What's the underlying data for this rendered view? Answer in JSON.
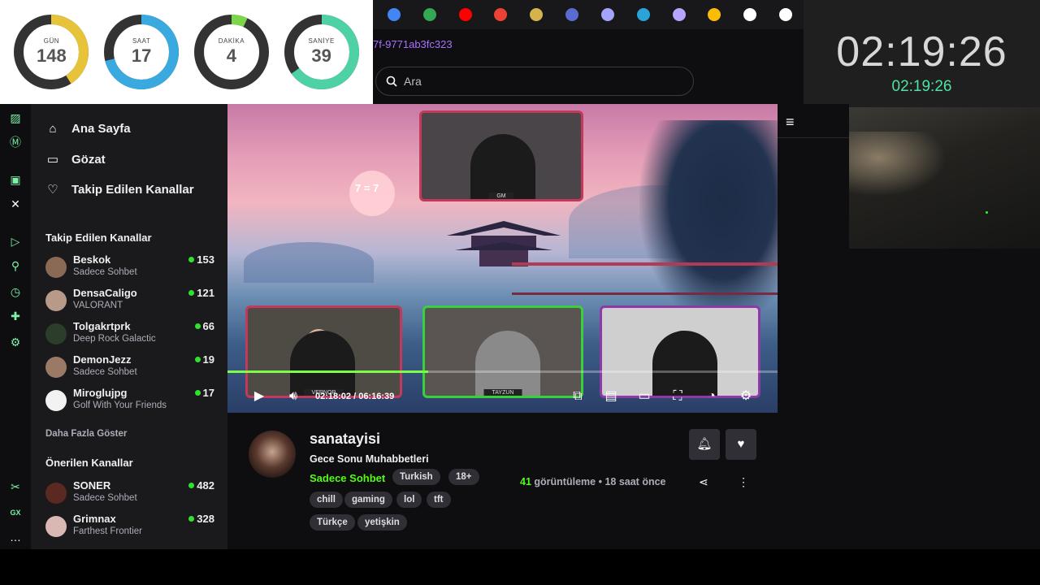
{
  "countdown": {
    "units": [
      {
        "label": "GÜN",
        "value": "148",
        "fraction": 0.41,
        "color": "#e7c33a"
      },
      {
        "label": "SAAT",
        "value": "17",
        "fraction": 0.71,
        "color": "#3aa9e0"
      },
      {
        "label": "DAKİKA",
        "value": "4",
        "fraction": 0.07,
        "color": "#7cd64a"
      },
      {
        "label": "SANİYE",
        "value": "39",
        "fraction": 0.65,
        "color": "#4fd1a6"
      }
    ]
  },
  "browser": {
    "bookmarks": [
      {
        "icon": "google-icon",
        "color": "#4285f4"
      },
      {
        "icon": "google-icon",
        "color": "#34a853"
      },
      {
        "icon": "youtube-icon",
        "color": "#ff0000"
      },
      {
        "icon": "google-icon",
        "color": "#ea4335"
      },
      {
        "icon": "download-icon",
        "color": "#d4b24c"
      },
      {
        "icon": "wordpress-icon",
        "color": "#5b6ad0"
      },
      {
        "icon": "document-icon",
        "color": "#a4a4ff"
      },
      {
        "icon": "globe-icon",
        "color": "#2aa3d8"
      },
      {
        "icon": "document-icon",
        "color": "#b6a4ff"
      },
      {
        "icon": "google-icon",
        "color": "#fbbc05"
      },
      {
        "icon": "wikipedia-icon",
        "color": "#ffffff"
      },
      {
        "icon": "wikipedia-icon",
        "color": "#ffffff"
      }
    ],
    "url_fragment": "7f-9771ab3fc323"
  },
  "search": {
    "placeholder": "Ara"
  },
  "clock": {
    "big": "02:19:26",
    "small": "02:19:26"
  },
  "nav": {
    "home": "Ana Sayfa",
    "browse": "Gözat",
    "following": "Takip Edilen Kanallar"
  },
  "followed": {
    "title": "Takip Edilen Kanallar",
    "channels": [
      {
        "name": "Beskok",
        "game": "Sadece Sohbet",
        "viewers": "153"
      },
      {
        "name": "DensaCaligo",
        "game": "VALORANT",
        "viewers": "121"
      },
      {
        "name": "Tolgakrtprk",
        "game": "Deep Rock Galactic",
        "viewers": "66"
      },
      {
        "name": "DemonJezz",
        "game": "Sadece Sohbet",
        "viewers": "19"
      },
      {
        "name": "Miroglujpg",
        "game": "Golf With Your Friends",
        "viewers": "17"
      }
    ],
    "show_more": "Daha Fazla Göster"
  },
  "recommended": {
    "title": "Önerilen Kanallar",
    "channels": [
      {
        "name": "SONER",
        "game": "Sadece Sohbet",
        "viewers": "482"
      },
      {
        "name": "Grimnax",
        "game": "Farthest Frontier",
        "viewers": "328"
      }
    ]
  },
  "video": {
    "overlay_badge": "7 = 7",
    "cam_tags": [
      "GM",
      "VERNOR",
      "TAYZUN"
    ],
    "time": "02:18:02 / 06:16:39",
    "progress": 0.365
  },
  "stream": {
    "channel": "sanatayisi",
    "title": "Gece Sonu Muhabbetleri",
    "category": "Sadece Sohbet",
    "tags": [
      "Turkish",
      "18+",
      "chill",
      "gaming",
      "lol",
      "tft",
      "Türkçe",
      "yetişkin"
    ],
    "views_count": "41",
    "views_label": "görüntüleme",
    "separator": "•",
    "ago": "18 saat önce"
  },
  "rail": {
    "gx_label": "GX"
  }
}
